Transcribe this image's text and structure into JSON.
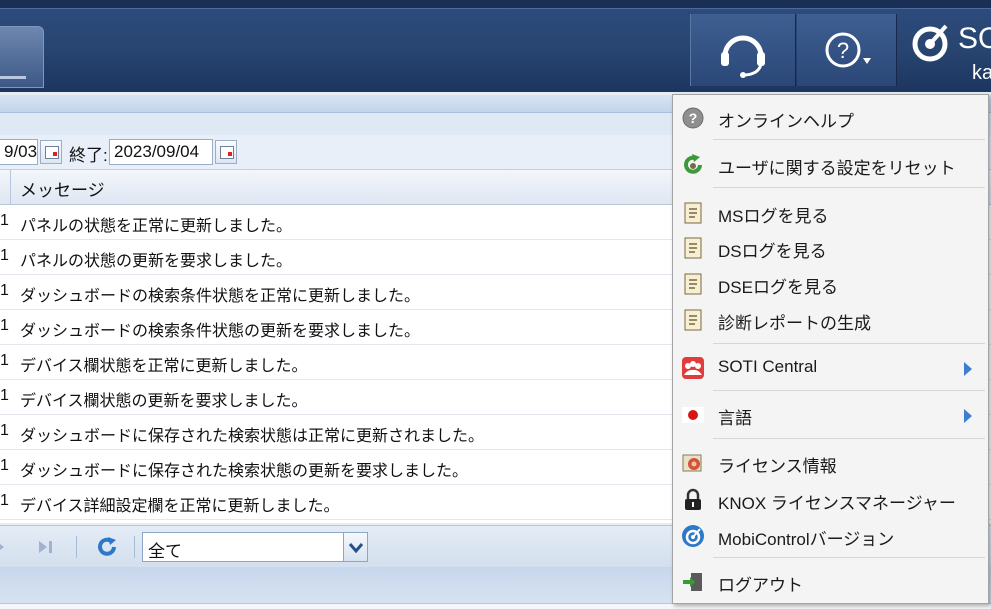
{
  "header": {
    "brand_text": "SO",
    "user_text": "ka",
    "support_icon": "headset-icon",
    "help_icon": "help-circle-icon"
  },
  "filter": {
    "start_date": "9/03",
    "end_label": "終了:",
    "end_date": "2023/09/04"
  },
  "grid": {
    "column_message": "メッセージ",
    "rows": [
      {
        "lead": "1",
        "message": "パネルの状態を正常に更新しました。"
      },
      {
        "lead": "1",
        "message": "パネルの状態の更新を要求しました。"
      },
      {
        "lead": "1",
        "message": "ダッシュボードの検索条件状態を正常に更新しました。"
      },
      {
        "lead": "1",
        "message": "ダッシュボードの検索条件状態の更新を要求しました。"
      },
      {
        "lead": "1",
        "message": "デバイス欄状態を正常に更新しました。"
      },
      {
        "lead": "1",
        "message": "デバイス欄状態の更新を要求しました。"
      },
      {
        "lead": "1",
        "message": "ダッシュボードに保存された検索状態は正常に更新されました。"
      },
      {
        "lead": "1",
        "message": "ダッシュボードに保存された検索状態の更新を要求しました。"
      },
      {
        "lead": "1",
        "message": "デバイス詳細設定欄を正常に更新しました。"
      }
    ]
  },
  "pager": {
    "filter_value": "全て"
  },
  "menu": {
    "items": [
      {
        "label": "オンラインヘルプ",
        "icon": "help-icon"
      },
      {
        "label": "ユーザに関する設定をリセット",
        "icon": "reset-icon"
      },
      {
        "label": "MSログを見る",
        "icon": "log-icon"
      },
      {
        "label": "DSログを見る",
        "icon": "log-icon"
      },
      {
        "label": "DSEログを見る",
        "icon": "log-icon"
      },
      {
        "label": "診断レポートの生成",
        "icon": "report-icon"
      },
      {
        "label": "SOTI Central",
        "icon": "soti-central-icon"
      },
      {
        "label": "言語",
        "icon": "language-flag-icon"
      },
      {
        "label": "ライセンス情報",
        "icon": "license-icon"
      },
      {
        "label": "KNOX ライセンスマネージャー",
        "icon": "lock-icon"
      },
      {
        "label": "MobiControlバージョン",
        "icon": "mobicontrol-icon"
      },
      {
        "label": "ログアウト",
        "icon": "logout-icon"
      }
    ]
  },
  "colors": {
    "header_bg": "#294672",
    "menu_bg": "#f4f4f4",
    "submenu_arrow": "#3c7fd0",
    "refresh_icon": "#2d78c8"
  }
}
